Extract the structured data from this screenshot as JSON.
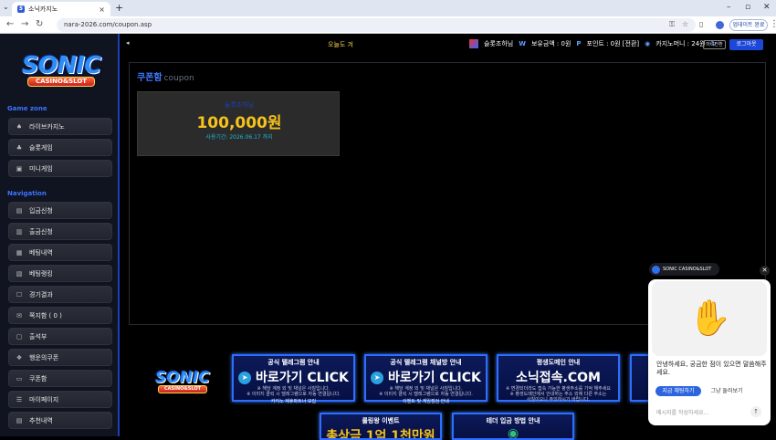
{
  "browser": {
    "tab_title": "소닉카지노",
    "tab_favicon": "S",
    "url": "nara-2026.com/coupon.asp",
    "update_button": "업데이트 완료",
    "new_tab": "+",
    "close": "×"
  },
  "sidebar": {
    "logo_text": "SONIC",
    "logo_sub": "CASINO&SLOT",
    "game_zone_title": "Game zone",
    "game_items": [
      {
        "label": "라이브카지노",
        "icon": "cards-icon"
      },
      {
        "label": "슬롯게임",
        "icon": "slot-icon"
      },
      {
        "label": "미니게임",
        "icon": "mini-game-icon"
      }
    ],
    "nav_title": "Navigation",
    "nav_items": [
      {
        "label": "입금신청",
        "icon": "deposit-icon"
      },
      {
        "label": "출금신청",
        "icon": "withdraw-icon"
      },
      {
        "label": "베팅내역",
        "icon": "bet-history-icon"
      },
      {
        "label": "베팅랭킹",
        "icon": "ranking-icon"
      },
      {
        "label": "경기결과",
        "icon": "result-icon"
      },
      {
        "label": "쪽지함 ( 0 )",
        "icon": "message-icon"
      },
      {
        "label": "출석부",
        "icon": "attendance-icon"
      },
      {
        "label": "행운의쿠폰",
        "icon": "lucky-coupon-icon"
      },
      {
        "label": "쿠폰함",
        "icon": "coupon-icon"
      },
      {
        "label": "마이페이지",
        "icon": "mypage-icon"
      },
      {
        "label": "추천내역",
        "icon": "referral-icon"
      }
    ]
  },
  "topbar": {
    "today": "오늘도 겨",
    "username": "슬롯조하님",
    "holding_label": "보유금액 : 0원",
    "point_label": "포인트 : 0원 [전환]",
    "casino_money_label": "카지노머니 : 24원",
    "money_button": "머니전환",
    "logout_button": "로그아웃"
  },
  "main": {
    "title": "쿠폰함",
    "title_en": "coupon",
    "coupon": {
      "label": "슬롯조하님",
      "amount": "100,000원",
      "expiry": "사용기간: 2026.06.17 까지"
    }
  },
  "banners": {
    "logo_text": "SONIC",
    "logo_sub": "CASINO&SLOT",
    "telegram": {
      "heading": "공식 텔레그램 안내",
      "big": "바로가기 CLICK",
      "line1": "※ 해당 계정 외 및 채널은 사칭입니다.",
      "line2": "※ 이미지 클릭 시 텔레그램으로 자동 연결됩니다.",
      "footer": "카지노 제휴파트너 모집"
    },
    "channel": {
      "heading": "공식 텔레그램 채널방 안내",
      "big": "바로가기 CLICK",
      "line1": "※ 해당 계정 외 및 채널은 사칭입니다.",
      "line2": "※ 이미지 클릭 시 텔레그램으로 자동 연결됩니다.",
      "footer": "이벤트 및 게임점검 안내"
    },
    "domain": {
      "heading": "평생도메인 안내",
      "big": "소닉접속.COM",
      "line1": "※ 변경되더라도 접속 가능한 평생주소를 기억 해주세요",
      "line2": "※ 평생도메인에서 안내하는 주소 외에 다른 주소는",
      "line3": "사칭이오니 주의하시기 바랍니다."
    },
    "rolling": {
      "heading": "롤링왕 이벤트",
      "big": "총상금 1억 1천만원"
    },
    "tether": {
      "heading": "테더 입금 방법 안내"
    }
  },
  "chat": {
    "brand": "SONIC CASINO&SLOT",
    "greeting": "안녕하세요, 궁금한 점이 있으면 말씀해주세요.",
    "chat_now": "지금 채팅하기",
    "later": "그냥 둘러보기",
    "input_placeholder": "메시지를 작성하세요..."
  },
  "colors": {
    "accent": "#1d3fb8",
    "gold": "#f6c21c",
    "sidebar_bg": "#101320"
  }
}
